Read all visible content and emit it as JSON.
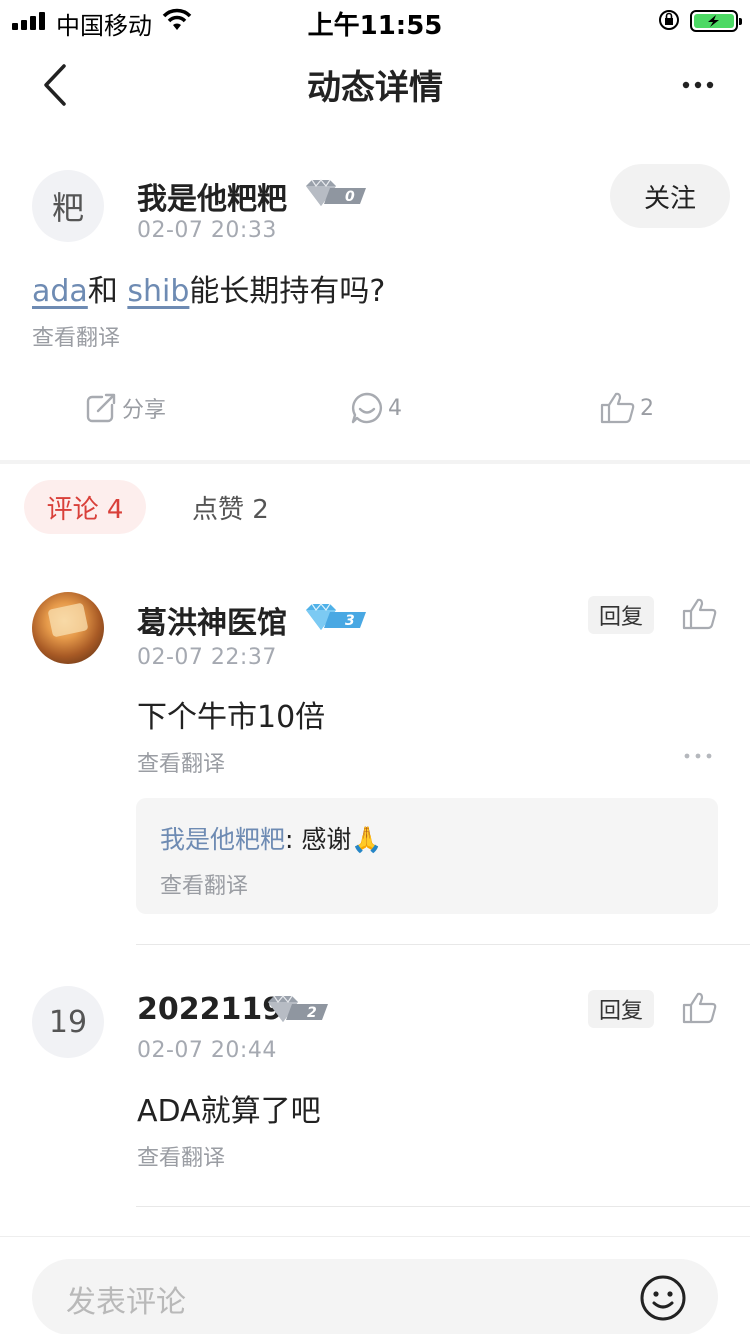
{
  "status_bar": {
    "carrier": "中国移动",
    "time": "上午11:55"
  },
  "nav": {
    "title": "动态详情"
  },
  "post": {
    "avatar_text": "粑",
    "username": "我是他粑粑",
    "badge_level": "0",
    "timestamp": "02-07 20:33",
    "follow_label": "关注",
    "content": {
      "tag1": "ada",
      "connector": "和",
      "tag2": "shib",
      "rest": "能长期持有吗?"
    },
    "translate": "查看翻译",
    "actions": {
      "share_label": "分享",
      "comment_count": "4",
      "like_count": "2"
    }
  },
  "tabs": {
    "comments": "评论 4",
    "likes": "点赞 2"
  },
  "comments": [
    {
      "username": "葛洪神医馆",
      "badge_level": "3",
      "timestamp": "02-07 22:37",
      "reply_label": "回复",
      "text": "下个牛市10倍",
      "translate": "查看翻译",
      "reply": {
        "user": "我是他粑粑",
        "separator": ": ",
        "text": "感谢🙏",
        "translate": "查看翻译"
      }
    },
    {
      "avatar_text": "19",
      "username": "2022119",
      "badge_level": "2",
      "timestamp": "02-07 20:44",
      "reply_label": "回复",
      "text": "ADA就算了吧",
      "translate": "查看翻译"
    }
  ],
  "bottom": {
    "placeholder": "发表评论"
  },
  "colors": {
    "accent_red": "#d9403a",
    "link_blue": "#6e8bb3",
    "battery_green": "#4cd964"
  },
  "icons": [
    "signal-icon",
    "wifi-icon",
    "rotation-lock-icon",
    "battery-icon",
    "back-icon",
    "more-icon",
    "diamond-badge-icon",
    "share-icon",
    "comment-icon",
    "like-icon",
    "emoji-icon"
  ]
}
